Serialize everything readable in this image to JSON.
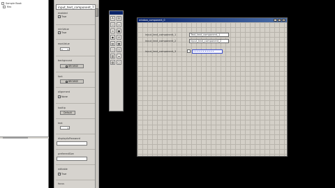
{
  "tree": {
    "items": [
      {
        "label": "Sample Book"
      },
      {
        "label": "flex"
      }
    ]
  },
  "props": {
    "title": "input_text_component_7",
    "sections": [
      {
        "label": "enabled"
      },
      {
        "label": "minValue"
      },
      {
        "label": "maxValue"
      },
      {
        "label": "background"
      },
      {
        "label": "font"
      },
      {
        "label": "alignment"
      },
      {
        "label": "tooltip"
      },
      {
        "label": "text"
      },
      {
        "label": "displayAsPassword"
      },
      {
        "label": "preferredSize"
      },
      {
        "label": "editable"
      },
      {
        "label": "focus"
      }
    ],
    "check_true": "True",
    "size_value": "1",
    "background_btn": "BROWSE",
    "font_btn": "BROWSE",
    "align_value": "None",
    "color_btn": "Default"
  },
  "toolbox": {
    "tools": [
      "A",
      "B",
      "☐",
      "▭",
      "≡",
      "▣",
      "◉",
      "☑",
      "▤",
      "▦",
      "○",
      "◫",
      "▥",
      "▴",
      "▧",
      "▢"
    ]
  },
  "designer": {
    "title": "window_component_0",
    "rows": [
      {
        "label": "input_text_component_1",
        "value": "Text_text_component_1"
      },
      {
        "label": "input_text_component_2",
        "value": "input_text_component_2"
      },
      {
        "label": "input_text_component_3",
        "value": "•••••••••••"
      }
    ]
  }
}
